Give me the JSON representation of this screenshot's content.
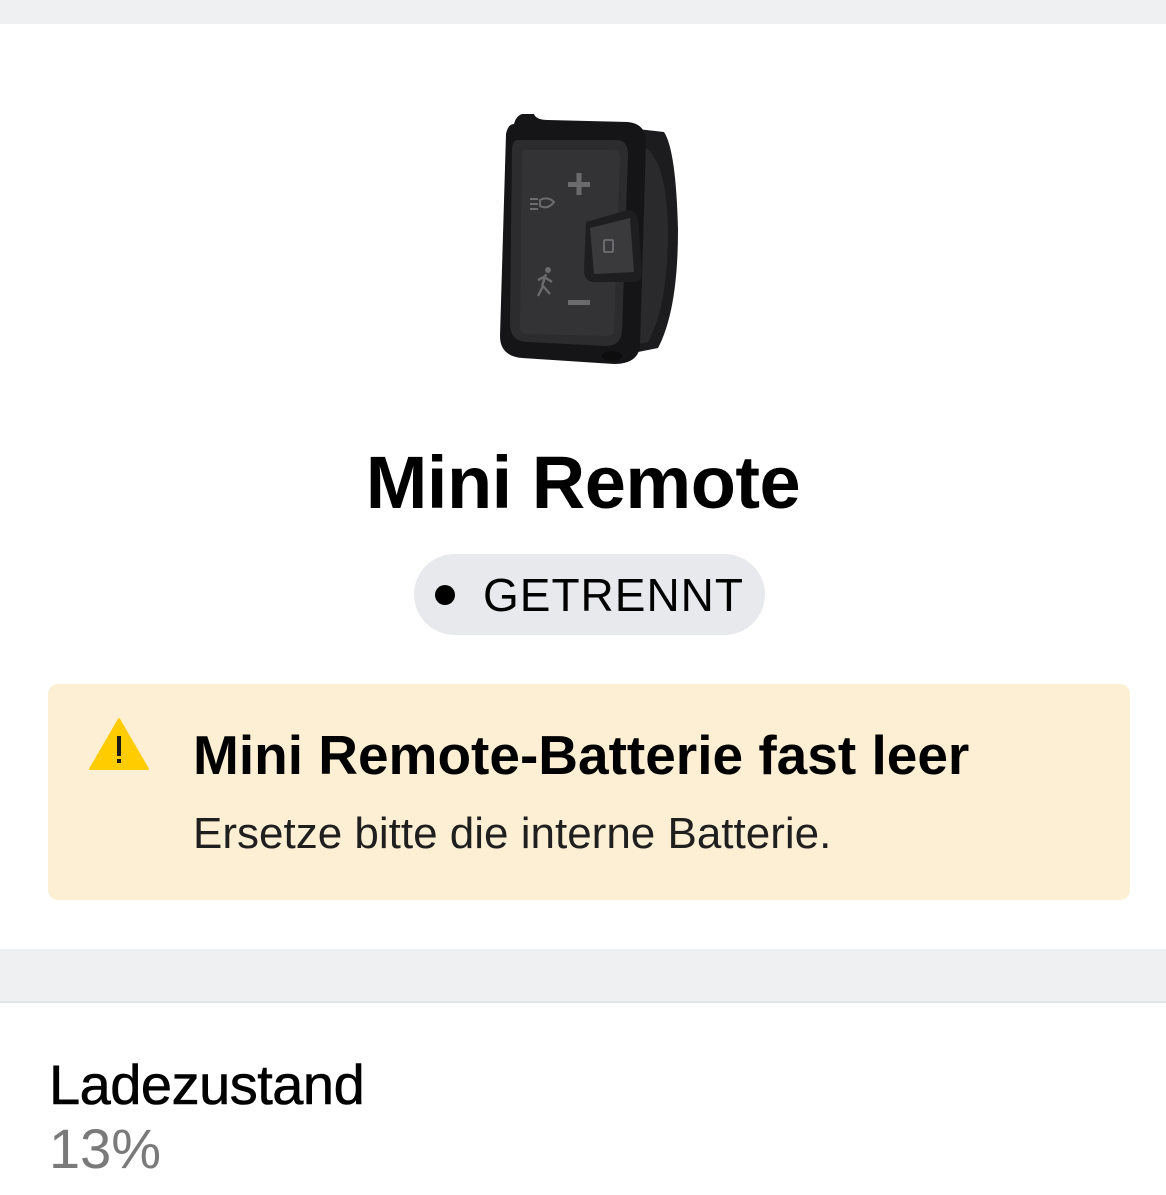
{
  "device": {
    "title": "Mini Remote",
    "image_icon": "mini-remote-device-image",
    "status": "GETRENNT"
  },
  "warning": {
    "icon": "warning-triangle-icon",
    "icon_color": "#ffcc00",
    "background": "#fdefd3",
    "title": "Mini Remote-Batterie fast leer",
    "subtitle": "Ersetze bitte die interne Batterie."
  },
  "battery": {
    "label": "Ladezustand",
    "value": "13%",
    "percent": 13
  }
}
